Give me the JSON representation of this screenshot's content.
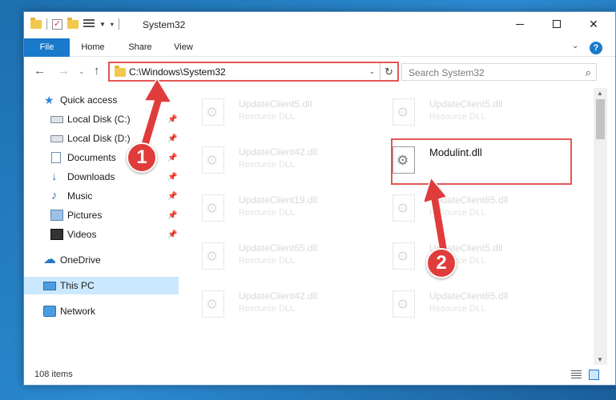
{
  "window": {
    "title": "System32"
  },
  "ribbon": {
    "tabs": [
      "File",
      "Home",
      "Share",
      "View"
    ],
    "help_label": "?"
  },
  "address": {
    "path": "C:\\Windows\\System32"
  },
  "search": {
    "placeholder": "Search System32"
  },
  "sidebar": {
    "items": [
      {
        "label": "Quick access",
        "icon": "star-icon"
      },
      {
        "label": "Local Disk (C:)",
        "icon": "disk-icon",
        "pinned": true
      },
      {
        "label": "Local Disk (D:)",
        "icon": "disk-icon",
        "pinned": true
      },
      {
        "label": "Documents",
        "icon": "document-icon",
        "pinned": true
      },
      {
        "label": "Downloads",
        "icon": "download-icon",
        "pinned": true
      },
      {
        "label": "Music",
        "icon": "music-icon",
        "pinned": true
      },
      {
        "label": "Pictures",
        "icon": "pictures-icon",
        "pinned": true
      },
      {
        "label": "Videos",
        "icon": "videos-icon",
        "pinned": true
      },
      {
        "label": "OneDrive",
        "icon": "cloud-icon"
      },
      {
        "label": "This PC",
        "icon": "computer-icon",
        "selected": true
      },
      {
        "label": "Network",
        "icon": "network-icon"
      }
    ]
  },
  "files": [
    {
      "name": "UpdateClient5.dll",
      "type": "Resource DLL"
    },
    {
      "name": "UpdateClient5.dll",
      "type": "Resource DLL"
    },
    {
      "name": "UpdateClient42.dll",
      "type": "Resource DLL"
    },
    {
      "name": "Modulint.dll",
      "type": "",
      "highlighted": true
    },
    {
      "name": "UpdateClient19.dll",
      "type": "Resource DLL"
    },
    {
      "name": "UpdateClient65.dll",
      "type": "Resource DLL"
    },
    {
      "name": "UpdateClient65.dll",
      "type": "Resource DLL"
    },
    {
      "name": "UpdateClient5.dll",
      "type": "Resource DLL"
    },
    {
      "name": "UpdateClient42.dll",
      "type": "Resource DLL"
    },
    {
      "name": "UpdateClient65.dll",
      "type": "Resource DLL"
    }
  ],
  "status": {
    "item_count": "108 items"
  },
  "callouts": [
    "1",
    "2"
  ],
  "colors": {
    "accent": "#1979ca",
    "highlight_red": "#e03c3c"
  }
}
